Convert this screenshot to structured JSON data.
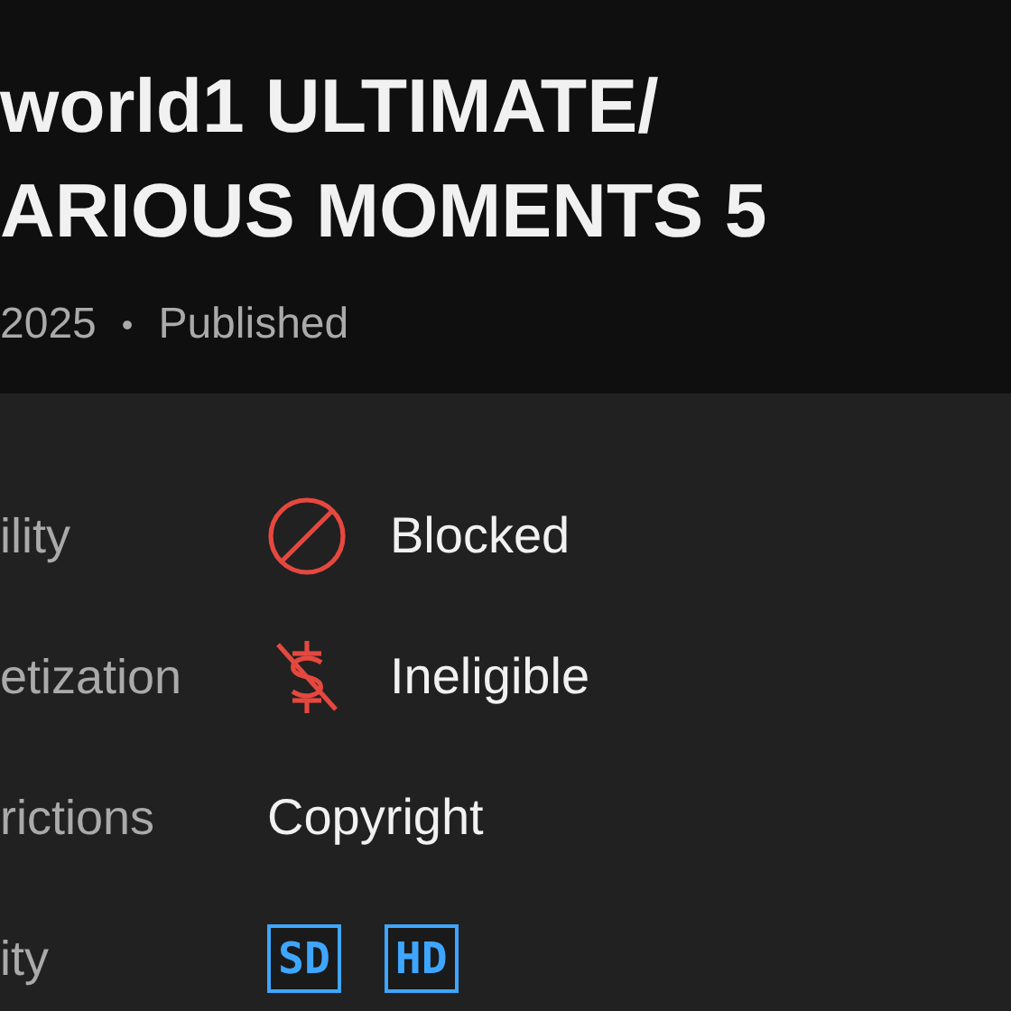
{
  "header": {
    "title_lines": [
      "world1 ULTIMATE/",
      "ARIOUS MOMENTS 5"
    ],
    "date": "2025",
    "separator": "•",
    "status": "Published"
  },
  "rows": [
    {
      "label": "ility",
      "kind": "blocked",
      "value": "Blocked"
    },
    {
      "label": "etization",
      "kind": "no-dollar",
      "value": "Ineligible"
    },
    {
      "label": "rictions",
      "kind": "text",
      "value": "Copyright"
    },
    {
      "label": "ity",
      "kind": "badges",
      "badges": [
        "SD",
        "HD"
      ]
    }
  ]
}
